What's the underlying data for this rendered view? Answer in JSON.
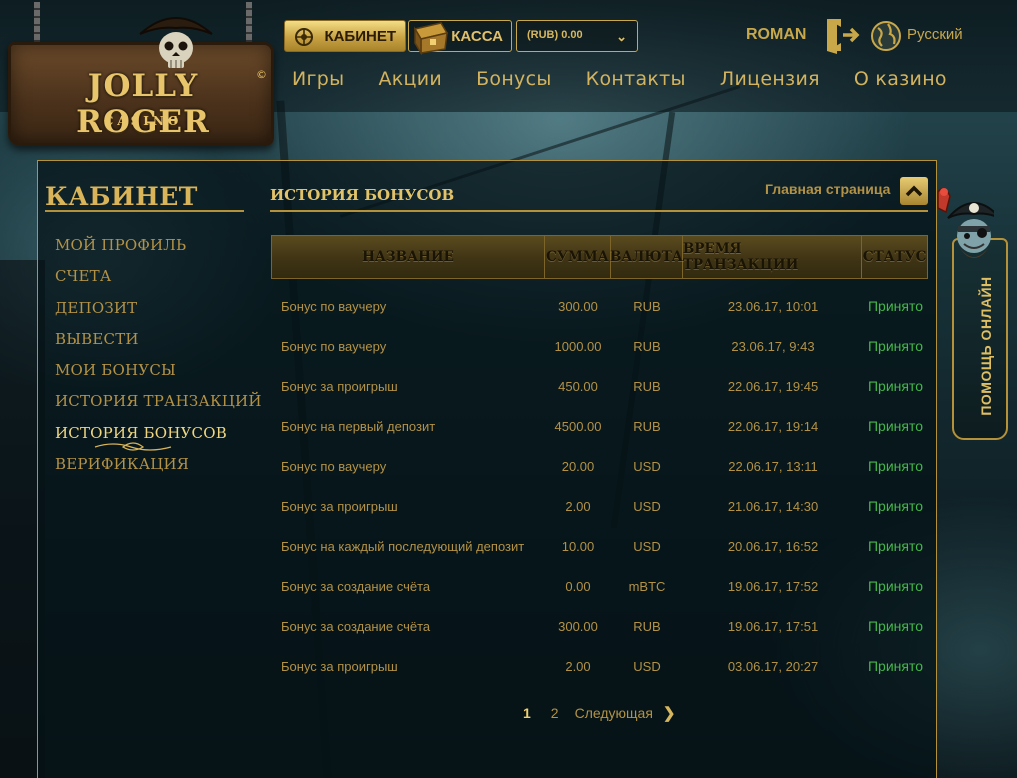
{
  "header": {
    "brand": "JOLLY ROGER",
    "brand_sub": "CASINO",
    "brand_mark": "©",
    "cabinet_button": "КАБИНЕТ",
    "kassa_button": "КАССА",
    "balance": "(RUB) 0.00",
    "username": "ROMAN",
    "language": "Русский",
    "nav": [
      "Игры",
      "Акции",
      "Бонусы",
      "Контакты",
      "Лицензия",
      "О казино"
    ]
  },
  "sidebar": {
    "title": "КАБИНЕТ",
    "items": [
      {
        "label": "МОЙ ПРОФИЛЬ",
        "active": false
      },
      {
        "label": "СЧЕТА",
        "active": false
      },
      {
        "label": "ДЕПОЗИТ",
        "active": false
      },
      {
        "label": "ВЫВЕСТИ",
        "active": false
      },
      {
        "label": "МОИ БОНУСЫ",
        "active": false
      },
      {
        "label": "ИСТОРИЯ ТРАНЗАКЦИЙ",
        "active": false
      },
      {
        "label": "ИСТОРИЯ БОНУСОВ",
        "active": true
      },
      {
        "label": "ВЕРИФИКАЦИЯ",
        "active": false
      }
    ]
  },
  "main": {
    "title": "ИСТОРИЯ БОНУСОВ",
    "home_link": "Главная страница",
    "columns": [
      "НАЗВАНИЕ",
      "СУММА",
      "ВАЛЮТА",
      "ВРЕМЯ ТРАНЗАКЦИИ",
      "СТАТУС"
    ],
    "rows": [
      {
        "name": "Бонус по ваучеру",
        "amount": "300.00",
        "currency": "RUB",
        "time": "23.06.17, 10:01",
        "status": "Принято"
      },
      {
        "name": "Бонус по ваучеру",
        "amount": "1000.00",
        "currency": "RUB",
        "time": "23.06.17, 9:43",
        "status": "Принято"
      },
      {
        "name": "Бонус за проигрыш",
        "amount": "450.00",
        "currency": "RUB",
        "time": "22.06.17, 19:45",
        "status": "Принято"
      },
      {
        "name": "Бонус на первый депозит",
        "amount": "4500.00",
        "currency": "RUB",
        "time": "22.06.17, 19:14",
        "status": "Принято"
      },
      {
        "name": "Бонус по ваучеру",
        "amount": "20.00",
        "currency": "USD",
        "time": "22.06.17, 13:11",
        "status": "Принято"
      },
      {
        "name": "Бонус за проигрыш",
        "amount": "2.00",
        "currency": "USD",
        "time": "21.06.17, 14:30",
        "status": "Принято"
      },
      {
        "name": "Бонус на каждый последующий депозит",
        "amount": "10.00",
        "currency": "USD",
        "time": "20.06.17, 16:52",
        "status": "Принято"
      },
      {
        "name": "Бонус за создание счёта",
        "amount": "0.00",
        "currency": "mBTC",
        "time": "19.06.17, 17:52",
        "status": "Принято"
      },
      {
        "name": "Бонус за создание счёта",
        "amount": "300.00",
        "currency": "RUB",
        "time": "19.06.17, 17:51",
        "status": "Принято"
      },
      {
        "name": "Бонус за проигрыш",
        "amount": "2.00",
        "currency": "USD",
        "time": "03.06.17, 20:27",
        "status": "Принято"
      }
    ],
    "pagination": {
      "current": "1",
      "pages": [
        "1",
        "2"
      ],
      "next_label": "Следующая"
    }
  },
  "help": {
    "label": "ПОМОЩЬ ОНЛАЙН"
  },
  "colors": {
    "gold": "#c9a84a",
    "status_ok": "#44b84a",
    "background": "#173138"
  }
}
